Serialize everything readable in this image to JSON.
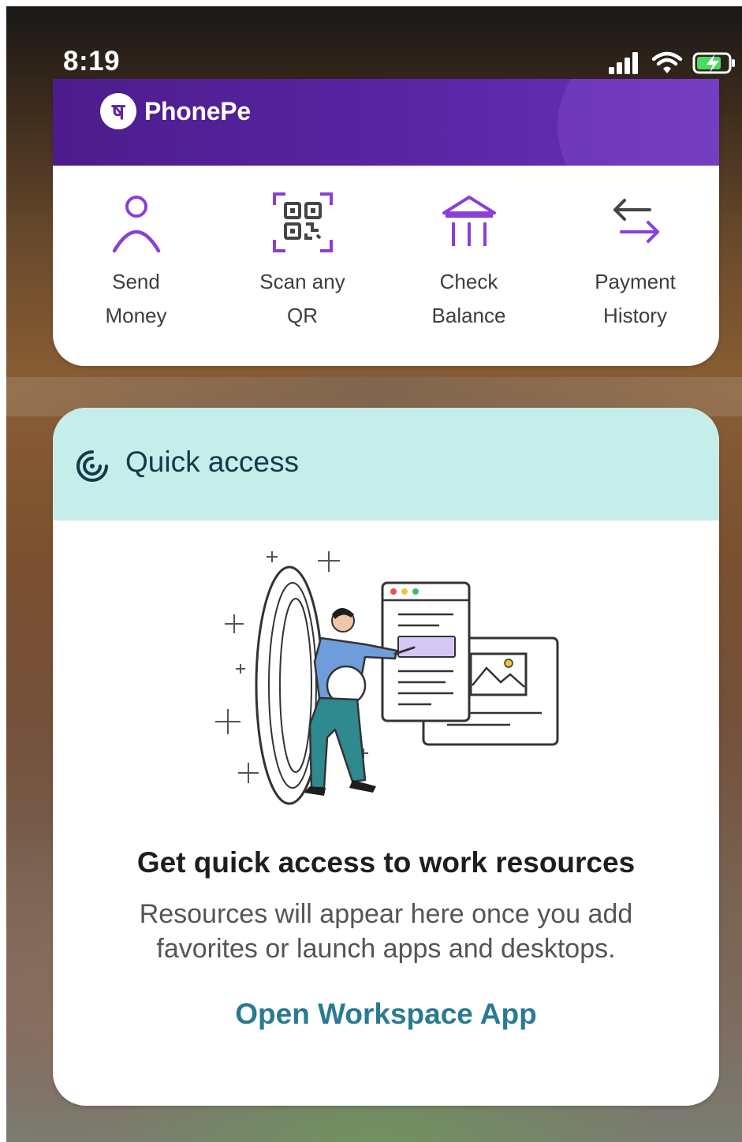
{
  "status_bar": {
    "time": "8:19"
  },
  "phonepe": {
    "brand": "PhonePe",
    "brand_logo_char": "ष",
    "accent": "#7a35c8",
    "actions": [
      {
        "line1": "Send",
        "line2": "Money",
        "icon": "person-icon"
      },
      {
        "line1": "Scan any",
        "line2": "QR",
        "icon": "qr-scan-icon"
      },
      {
        "line1": "Check",
        "line2": "Balance",
        "icon": "bank-icon"
      },
      {
        "line1": "Payment",
        "line2": "History",
        "icon": "transfer-arrows-icon"
      }
    ]
  },
  "quick_access": {
    "title": "Quick access",
    "heading": "Get quick access to work resources",
    "description": "Resources will appear here once you add favorites or launch apps and desktops.",
    "link": "Open Workspace App",
    "colors": {
      "header_bg": "#c5ede9",
      "link": "#2a7a92"
    }
  }
}
